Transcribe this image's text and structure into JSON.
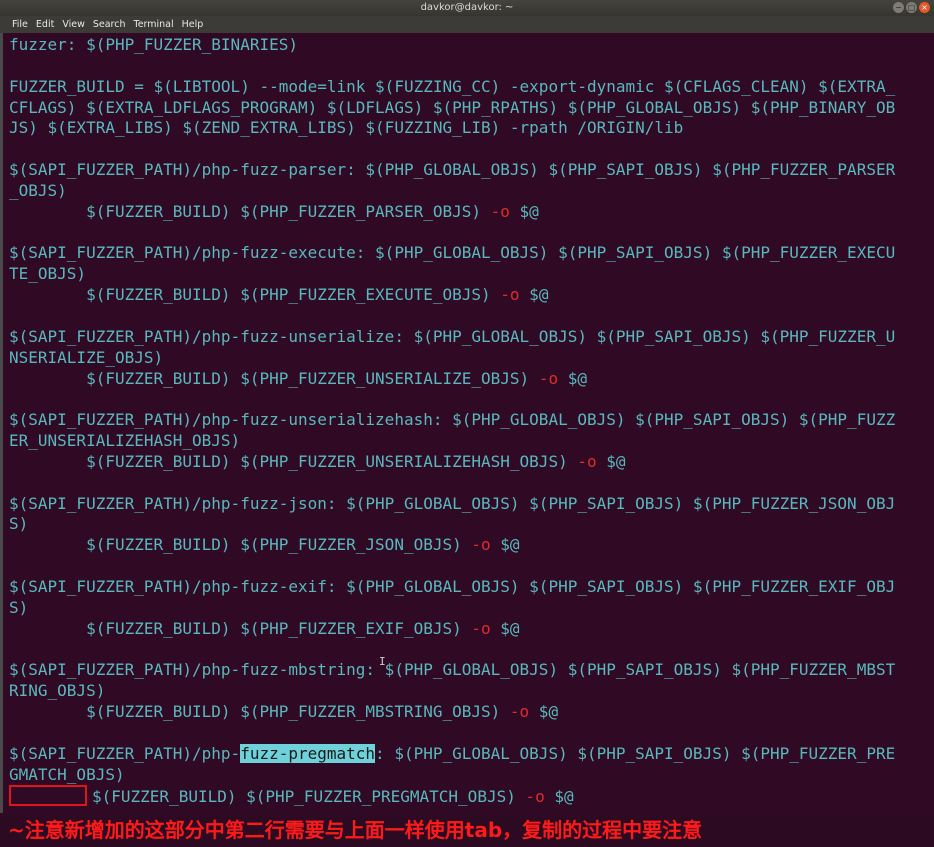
{
  "window": {
    "title": "davkor@davkor: ~",
    "buttons": [
      "−",
      "□",
      "×"
    ]
  },
  "menubar": [
    "File",
    "Edit",
    "View",
    "Search",
    "Terminal",
    "Help"
  ],
  "terminal": {
    "lines": [
      [
        {
          "t": "fuzzer: $(PHP_FUZZER_BINARIES)"
        }
      ],
      [
        {
          "t": ""
        }
      ],
      [
        {
          "t": "FUZZER_BUILD = $(LIBTOOL) --mode=link $(FUZZING_CC) -export-dynamic $(CFLAGS_CLEAN) $(EXTRA_"
        }
      ],
      [
        {
          "t": "CFLAGS) $(EXTRA_LDFLAGS_PROGRAM) $(LDFLAGS) $(PHP_RPATHS) $(PHP_GLOBAL_OBJS) $(PHP_BINARY_OB"
        }
      ],
      [
        {
          "t": "JS) $(EXTRA_LIBS) $(ZEND_EXTRA_LIBS) $(FUZZING_LIB) -rpath /ORIGIN/lib"
        }
      ],
      [
        {
          "t": ""
        }
      ],
      [
        {
          "t": "$(SAPI_FUZZER_PATH)/php-fuzz-parser: $(PHP_GLOBAL_OBJS) $(PHP_SAPI_OBJS) $(PHP_FUZZER_PARSER"
        }
      ],
      [
        {
          "t": "_OBJS)"
        }
      ],
      [
        {
          "t": "        $(FUZZER_BUILD) $(PHP_FUZZER_PARSER_OBJS) "
        },
        {
          "t": "-o",
          "c": "opt"
        },
        {
          "t": " $@"
        }
      ],
      [
        {
          "t": ""
        }
      ],
      [
        {
          "t": "$(SAPI_FUZZER_PATH)/php-fuzz-execute: $(PHP_GLOBAL_OBJS) $(PHP_SAPI_OBJS) $(PHP_FUZZER_EXECU"
        }
      ],
      [
        {
          "t": "TE_OBJS)"
        }
      ],
      [
        {
          "t": "        $(FUZZER_BUILD) $(PHP_FUZZER_EXECUTE_OBJS) "
        },
        {
          "t": "-o",
          "c": "opt"
        },
        {
          "t": " $@"
        }
      ],
      [
        {
          "t": ""
        }
      ],
      [
        {
          "t": "$(SAPI_FUZZER_PATH)/php-fuzz-unserialize: $(PHP_GLOBAL_OBJS) $(PHP_SAPI_OBJS) $(PHP_FUZZER_U"
        }
      ],
      [
        {
          "t": "NSERIALIZE_OBJS)"
        }
      ],
      [
        {
          "t": "        $(FUZZER_BUILD) $(PHP_FUZZER_UNSERIALIZE_OBJS) "
        },
        {
          "t": "-o",
          "c": "opt"
        },
        {
          "t": " $@"
        }
      ],
      [
        {
          "t": ""
        }
      ],
      [
        {
          "t": "$(SAPI_FUZZER_PATH)/php-fuzz-unserializehash: $(PHP_GLOBAL_OBJS) $(PHP_SAPI_OBJS) $(PHP_FUZZ"
        }
      ],
      [
        {
          "t": "ER_UNSERIALIZEHASH_OBJS)"
        }
      ],
      [
        {
          "t": "        $(FUZZER_BUILD) $(PHP_FUZZER_UNSERIALIZEHASH_OBJS) "
        },
        {
          "t": "-o",
          "c": "opt"
        },
        {
          "t": " $@"
        }
      ],
      [
        {
          "t": ""
        }
      ],
      [
        {
          "t": "$(SAPI_FUZZER_PATH)/php-fuzz-json: $(PHP_GLOBAL_OBJS) $(PHP_SAPI_OBJS) $(PHP_FUZZER_JSON_OBJ"
        }
      ],
      [
        {
          "t": "S)"
        }
      ],
      [
        {
          "t": "        $(FUZZER_BUILD) $(PHP_FUZZER_JSON_OBJS) "
        },
        {
          "t": "-o",
          "c": "opt"
        },
        {
          "t": " $@"
        }
      ],
      [
        {
          "t": ""
        }
      ],
      [
        {
          "t": "$(SAPI_FUZZER_PATH)/php-fuzz-exif: $(PHP_GLOBAL_OBJS) $(PHP_SAPI_OBJS) $(PHP_FUZZER_EXIF_OBJ"
        }
      ],
      [
        {
          "t": "S)"
        }
      ],
      [
        {
          "t": "        $(FUZZER_BUILD) $(PHP_FUZZER_EXIF_OBJS) "
        },
        {
          "t": "-o",
          "c": "opt"
        },
        {
          "t": " $@"
        }
      ],
      [
        {
          "t": ""
        }
      ],
      [
        {
          "t": "$(SAPI_FUZZER_PATH)/php-fuzz-mbstring: $(PHP_GLOBAL_OBJS) $(PHP_SAPI_OBJS) $(PHP_FUZZER_MBST"
        }
      ],
      [
        {
          "t": "RING_OBJS)"
        }
      ],
      [
        {
          "t": "        $(FUZZER_BUILD) $(PHP_FUZZER_MBSTRING_OBJS) "
        },
        {
          "t": "-o",
          "c": "opt"
        },
        {
          "t": " $@"
        }
      ],
      [
        {
          "t": ""
        }
      ],
      [
        {
          "t": "$(SAPI_FUZZER_PATH)/php-"
        },
        {
          "t": "fuzz-pregmatch",
          "c": "hl"
        },
        {
          "t": ": $(PHP_GLOBAL_OBJS) $(PHP_SAPI_OBJS) $(PHP_FUZZER_PRE"
        }
      ],
      [
        {
          "t": "GMATCH_OBJS)"
        }
      ],
      [
        {
          "t": "",
          "c": "tabbox"
        },
        {
          "t": "$(FUZZER_BUILD) $(PHP_FUZZER_PREGMATCH_OBJS) "
        },
        {
          "t": "-o",
          "c": "opt"
        },
        {
          "t": " $@"
        }
      ]
    ]
  },
  "annotation": "~注意新增加的这部分中第二行需要与上面一样使用tab，复制的过程中要注意"
}
